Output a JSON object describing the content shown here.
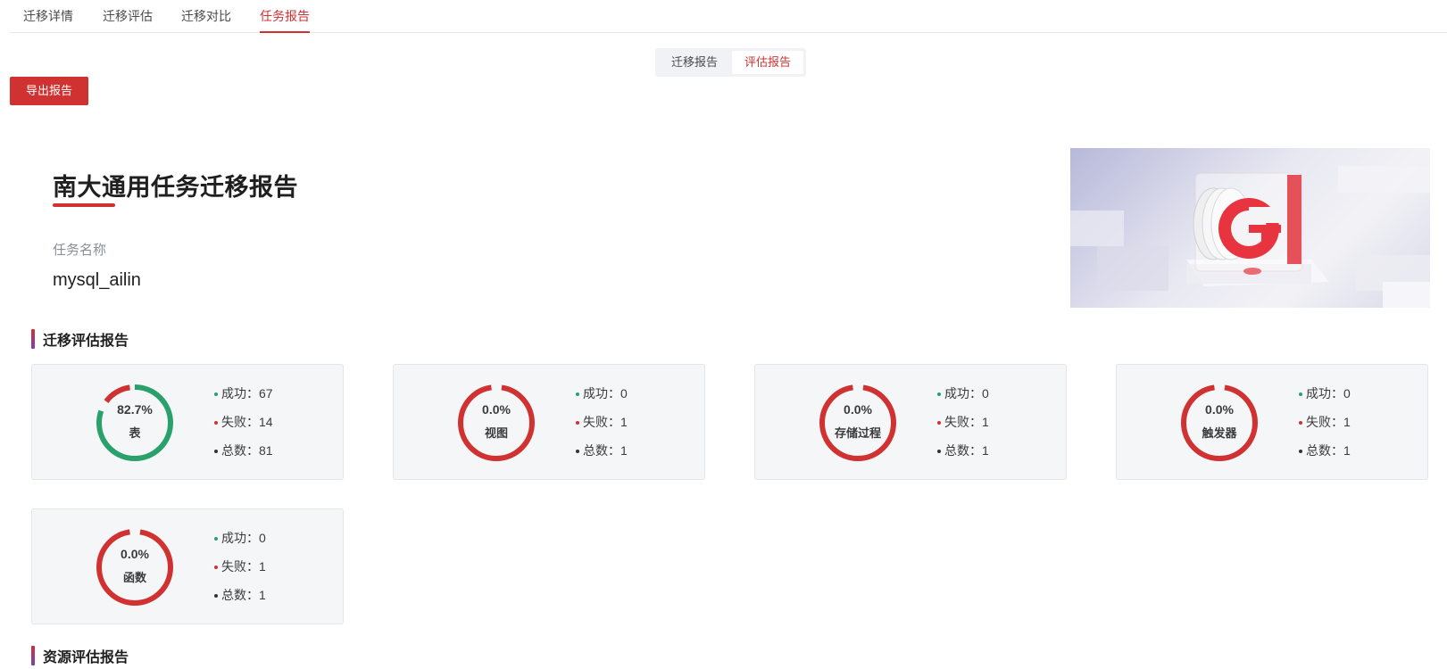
{
  "tabs": [
    {
      "label": "迁移详情",
      "active": false
    },
    {
      "label": "迁移评估",
      "active": false
    },
    {
      "label": "迁移对比",
      "active": false
    },
    {
      "label": "任务报告",
      "active": true
    }
  ],
  "report_toggle": {
    "options": [
      "迁移报告",
      "评估报告"
    ],
    "selected": "评估报告"
  },
  "export_button": "导出报告",
  "report": {
    "title": "南大通用任务迁移报告",
    "task_name_label": "任务名称",
    "task_name": "mysql_ailin"
  },
  "sections": {
    "migration_eval": "迁移评估报告",
    "resource_eval": "资源评估报告"
  },
  "stat_labels": {
    "success": "成功：",
    "fail": "失败：",
    "total": "总数："
  },
  "colors": {
    "accent": "#d03131",
    "success": "#2aa06a",
    "card_bg": "#f5f6f8"
  },
  "cards": [
    {
      "name": "表",
      "percent": "82.7%",
      "ratio": 0.827,
      "success": "67",
      "fail": "14",
      "total": "81"
    },
    {
      "name": "视图",
      "percent": "0.0%",
      "ratio": 0,
      "success": "0",
      "fail": "1",
      "total": "1"
    },
    {
      "name": "存储过程",
      "percent": "0.0%",
      "ratio": 0,
      "success": "0",
      "fail": "1",
      "total": "1"
    },
    {
      "name": "触发器",
      "percent": "0.0%",
      "ratio": 0,
      "success": "0",
      "fail": "1",
      "total": "1"
    },
    {
      "name": "函数",
      "percent": "0.0%",
      "ratio": 0,
      "success": "0",
      "fail": "1",
      "total": "1"
    }
  ]
}
